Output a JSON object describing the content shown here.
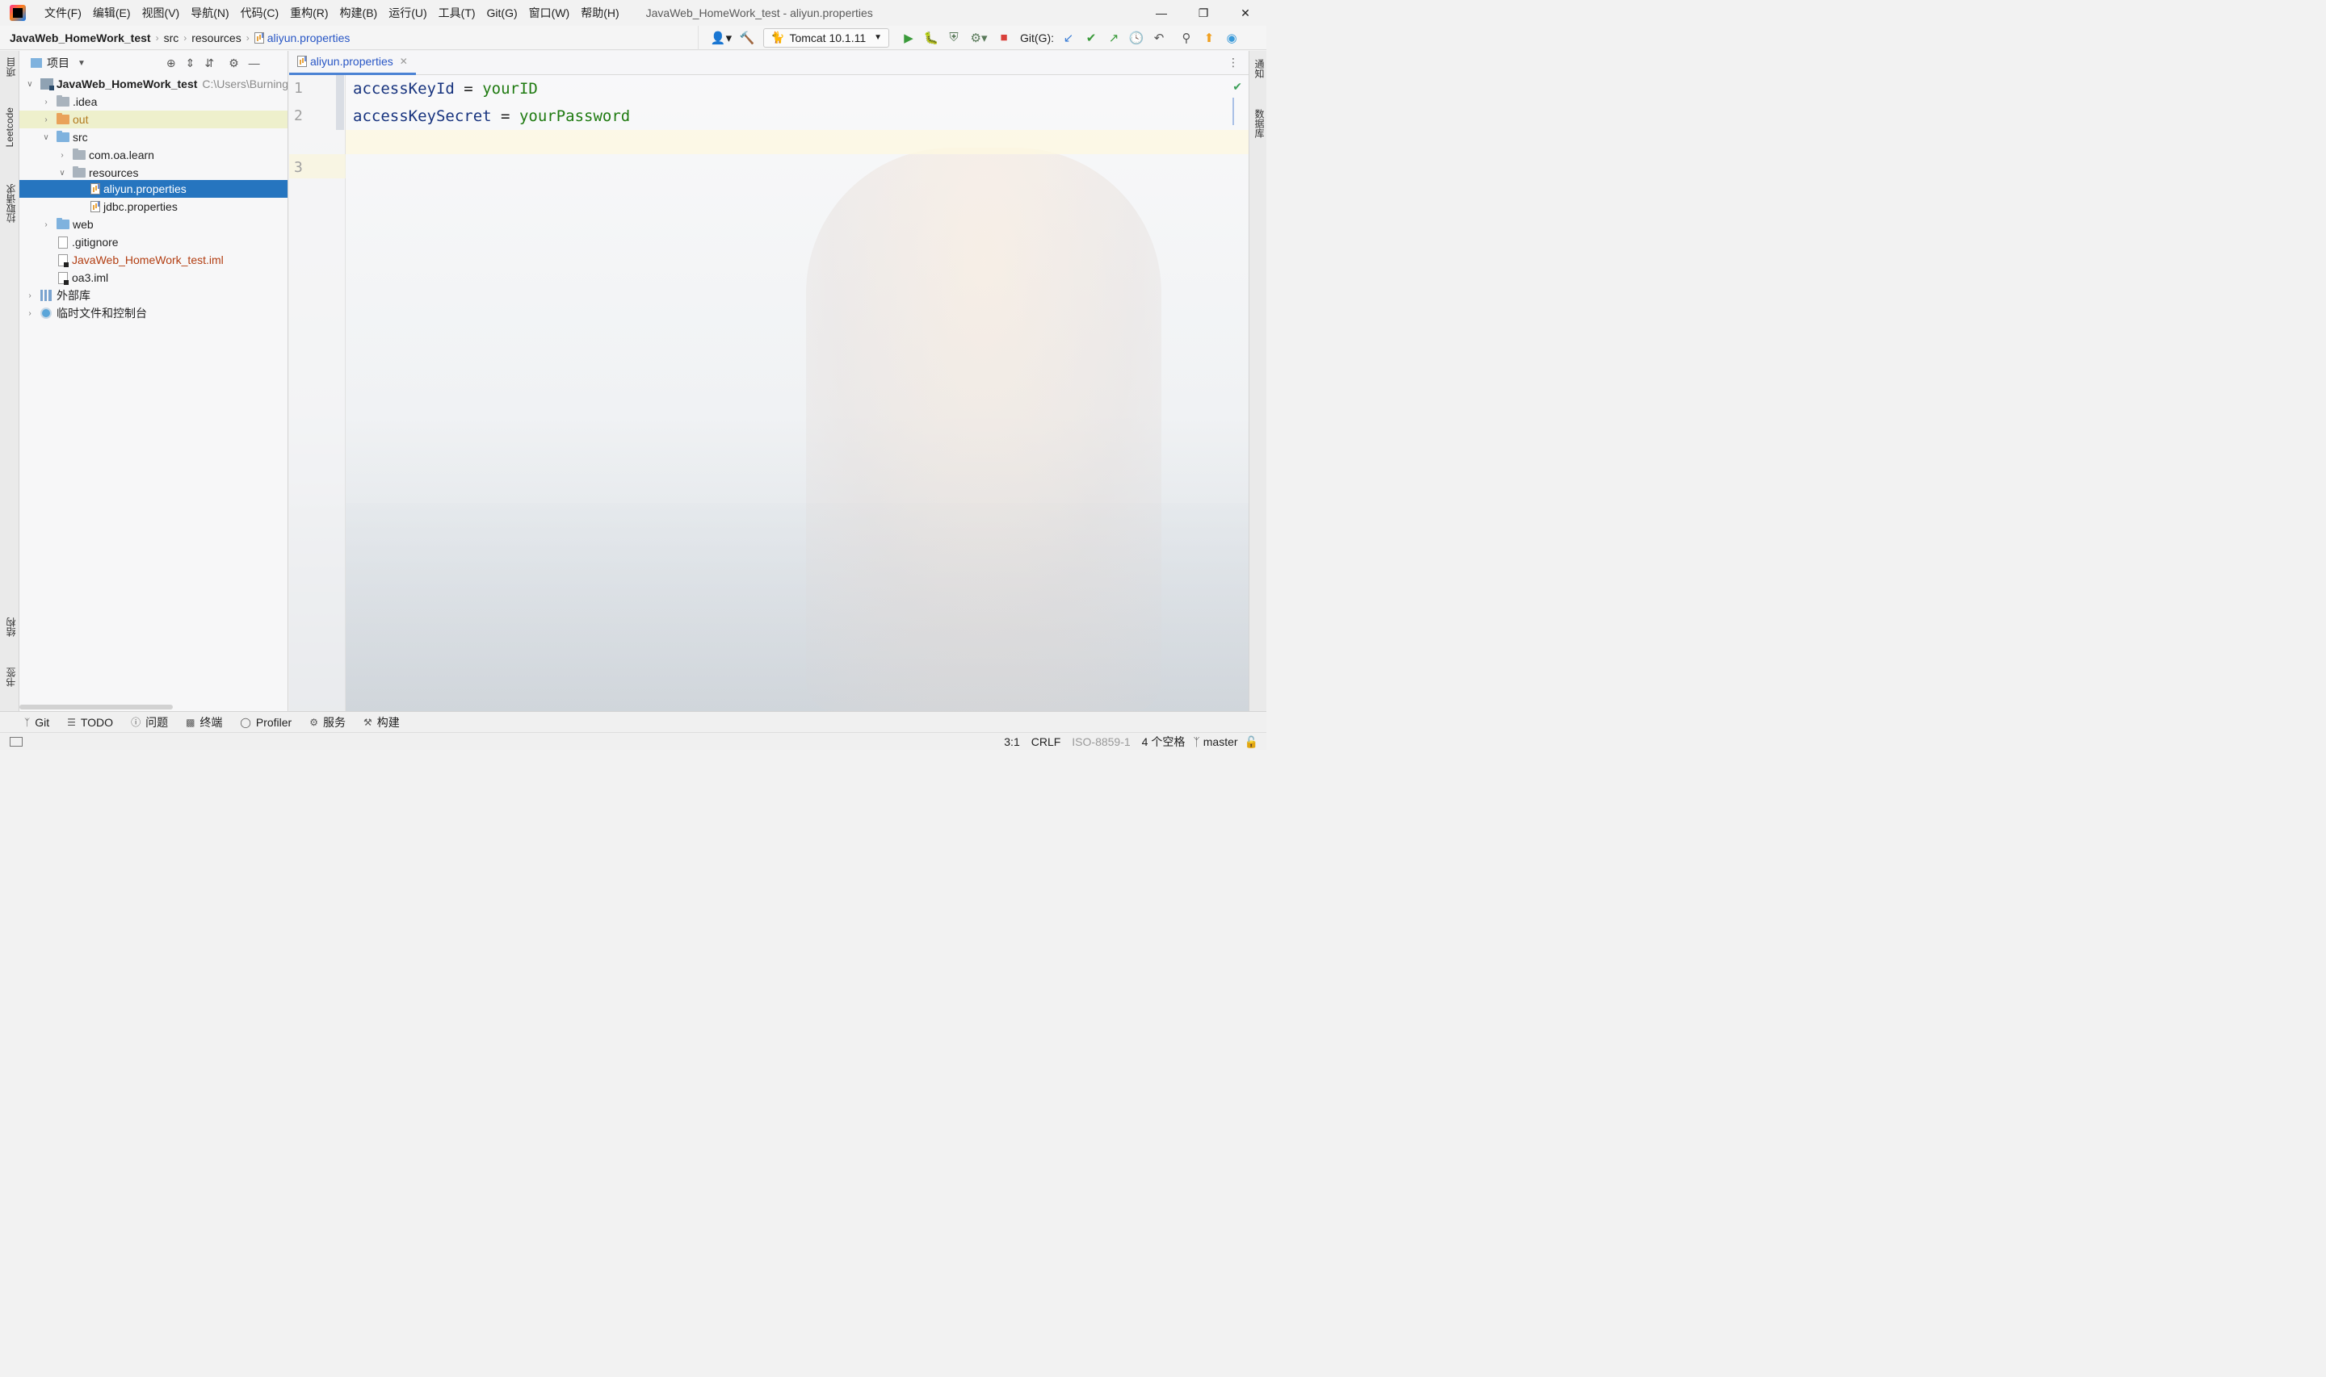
{
  "titlebar": {
    "menus": [
      "文件(F)",
      "编辑(E)",
      "视图(V)",
      "导航(N)",
      "代码(C)",
      "重构(R)",
      "构建(B)",
      "运行(U)",
      "工具(T)",
      "Git(G)",
      "窗口(W)",
      "帮助(H)"
    ],
    "window_title": "JavaWeb_HomeWork_test - aliyun.properties",
    "controls": {
      "minimize": "—",
      "restore": "❐",
      "close": "✕"
    }
  },
  "navbar": {
    "breadcrumbs": [
      "JavaWeb_HomeWork_test",
      "src",
      "resources",
      "aliyun.properties"
    ],
    "run_config": "Tomcat 10.1.11",
    "git_label": "Git(G):"
  },
  "left_strip": {
    "top_tabs": [
      "项目",
      "Leetcode",
      "拉取请求"
    ],
    "bottom_tabs": [
      "结构",
      "书签"
    ]
  },
  "right_strip": {
    "tabs": [
      "通知",
      "数据库"
    ]
  },
  "project": {
    "header": "项目",
    "tree": [
      {
        "label": "JavaWeb_HomeWork_test",
        "hint": "C:\\Users\\Burning"
      },
      {
        "label": ".idea"
      },
      {
        "label": "out"
      },
      {
        "label": "src"
      },
      {
        "label": "com.oa.learn"
      },
      {
        "label": "resources"
      },
      {
        "label": "aliyun.properties"
      },
      {
        "label": "jdbc.properties"
      },
      {
        "label": "web"
      },
      {
        "label": ".gitignore"
      },
      {
        "label": "JavaWeb_HomeWork_test.iml"
      },
      {
        "label": "oa3.iml"
      },
      {
        "label": "外部库"
      },
      {
        "label": "临时文件和控制台"
      }
    ]
  },
  "editor": {
    "tab": "aliyun.properties",
    "line_numbers": [
      "1",
      "2",
      "3"
    ],
    "lines": [
      {
        "key": "accessKeyId",
        "eq": "=",
        "value": "yourID"
      },
      {
        "key": "accessKeySecret",
        "eq": "=",
        "value": "yourPassword"
      }
    ]
  },
  "bottom_tools": [
    "Git",
    "TODO",
    "问题",
    "终端",
    "Profiler",
    "服务",
    "构建"
  ],
  "status": {
    "position": "3:1",
    "line_sep": "CRLF",
    "encoding": "ISO-8859-1",
    "indent": "4 个空格",
    "branch": "master"
  },
  "colors": {
    "selection": "#2675bf",
    "key": "#17337e",
    "value": "#1e7a10",
    "link": "#2856c5"
  }
}
